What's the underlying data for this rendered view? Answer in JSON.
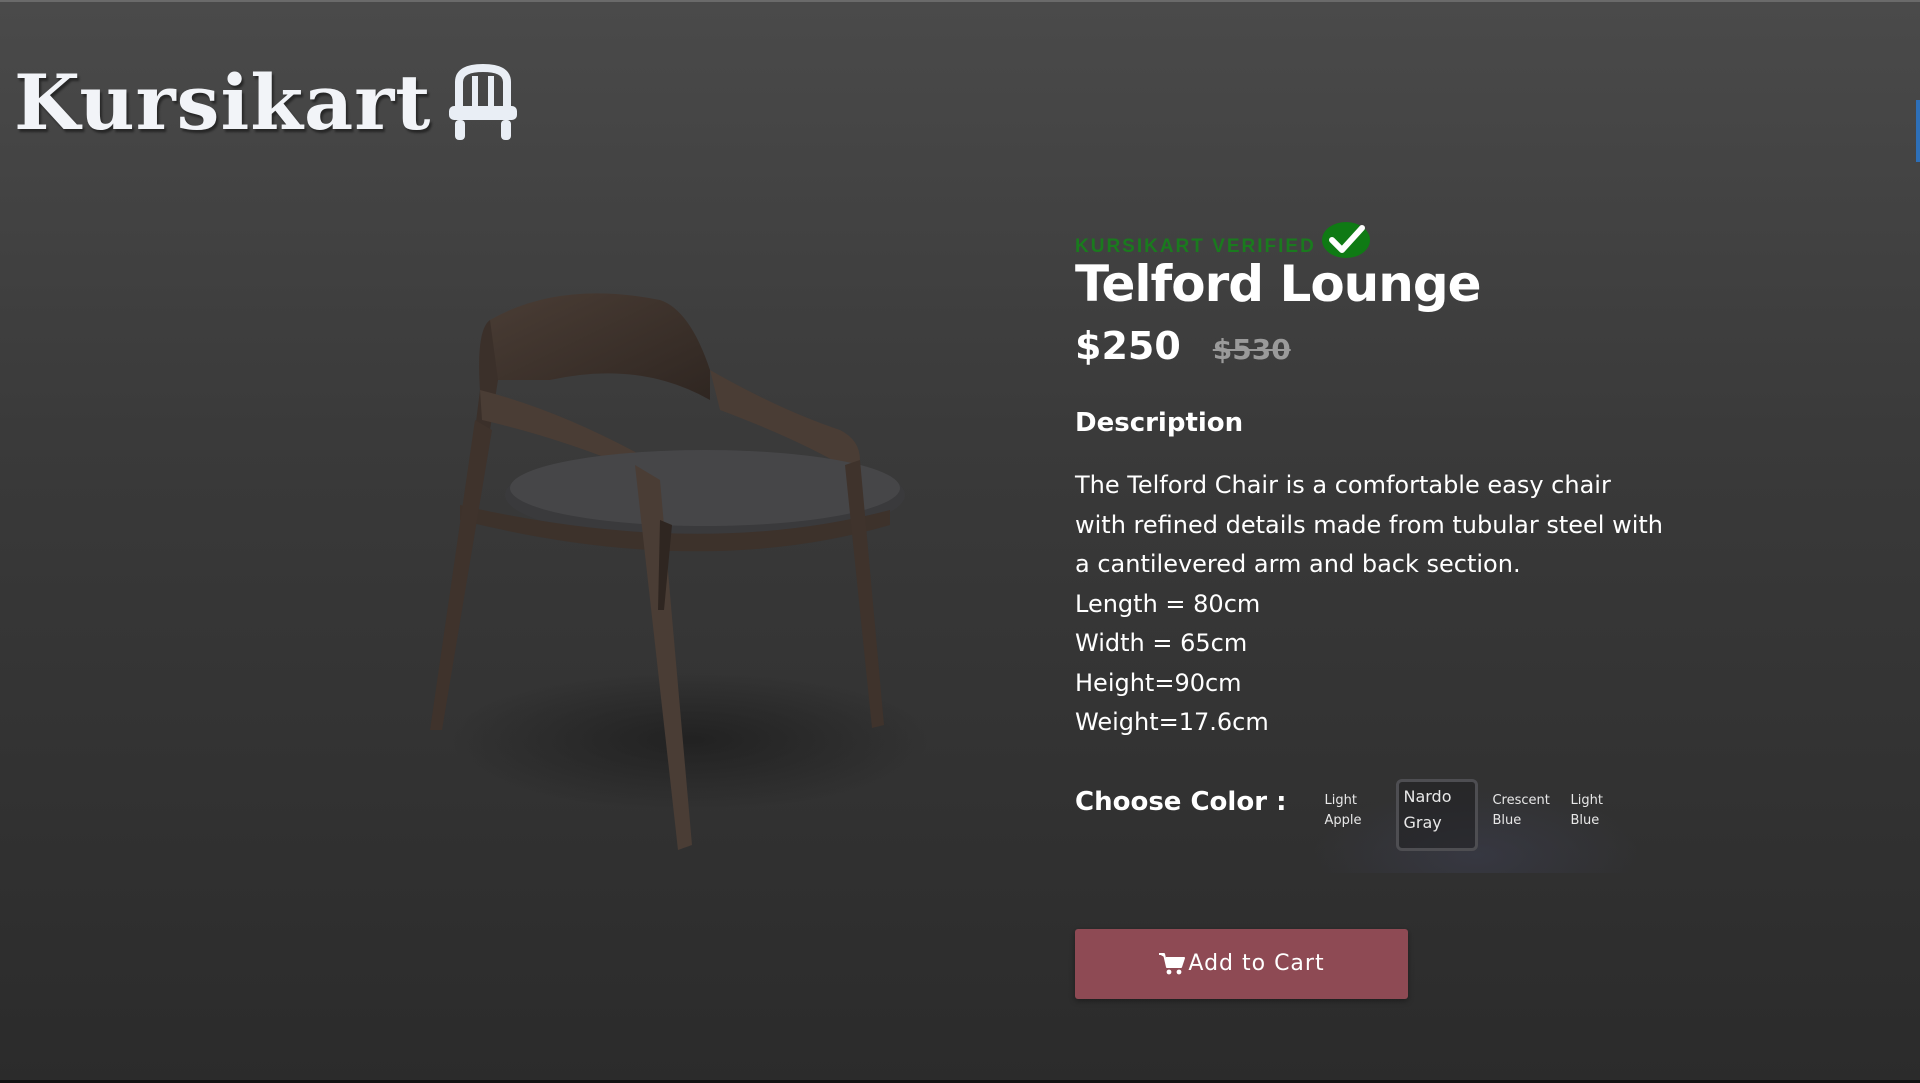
{
  "brand": {
    "name": "Kursikart",
    "logo_icon": "chair-icon"
  },
  "product": {
    "verified_label": "KURSIKART VERIFIED",
    "verified_icon": "checkmark-icon",
    "title": "Telford Lounge",
    "price": "$250",
    "old_price": "$530",
    "description_heading": "Description",
    "description": "The Telford Chair is a comfortable easy chair with refined details made from tubular steel with a cantilevered arm and back section.",
    "specs": [
      "Length = 80cm",
      "Width = 65cm",
      "Height=90cm",
      "Weight=17.6cm"
    ]
  },
  "color_picker": {
    "label": "Choose Color :",
    "options": [
      "Light Apple",
      "Nardo Gray",
      "Crescent Blue",
      "Light Blue"
    ],
    "selected": "Nardo Gray"
  },
  "actions": {
    "add_to_cart_label": "Add to Cart",
    "cart_icon": "cart-icon"
  },
  "colors": {
    "verified_green": "#1a7a1e",
    "button": "#8e4a54",
    "background": "#3a3a3a"
  }
}
